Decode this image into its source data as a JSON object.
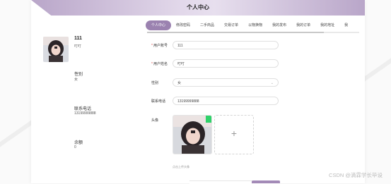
{
  "header": {
    "title": "个人中心"
  },
  "tabs": [
    {
      "label": "个人中心"
    },
    {
      "label": "修改密码"
    },
    {
      "label": "二手商品"
    },
    {
      "label": "交易订单"
    },
    {
      "label": "以物换物"
    },
    {
      "label": "我的发布"
    },
    {
      "label": "我的订单"
    },
    {
      "label": "我的地址"
    },
    {
      "label": "我"
    }
  ],
  "profile": {
    "name": "111",
    "nickname": "叮叮",
    "gender_label": "性别",
    "gender_value": "女",
    "phone_label": "联系电话",
    "phone_value": "13199999888",
    "balance_label": "余额",
    "balance_value": "0"
  },
  "form": {
    "account_label": "用户账号",
    "account_value": "111",
    "username_label": "用户姓名",
    "username_value": "叮叮",
    "gender_label": "性别",
    "gender_value": "女",
    "phone_label": "联系电话",
    "phone_value": "13199999888",
    "avatar_label": "头像",
    "upload_hint": "点击上传头像",
    "plus": "+"
  },
  "watermark": "CSDN @滴霖学长毕设",
  "colors": {
    "accent": "#9b82b0",
    "required": "#e04a4a"
  }
}
